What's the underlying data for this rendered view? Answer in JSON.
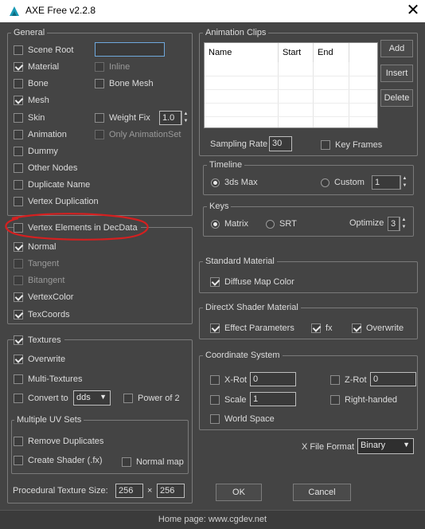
{
  "window": {
    "title": "AXE Free v2.2.8",
    "close_glyph": "✕",
    "icon": "axe-app-icon"
  },
  "general": {
    "title": "General",
    "scene_root": "Scene Root",
    "scene_root_value": "",
    "material": "Material",
    "inline": "Inline",
    "bone": "Bone",
    "bone_mesh": "Bone Mesh",
    "mesh": "Mesh",
    "skin": "Skin",
    "weight_fix": "Weight Fix",
    "weight_fix_value": "1.0",
    "animation": "Animation",
    "only_animation_set": "Only AnimationSet",
    "dummy": "Dummy",
    "other_nodes": "Other Nodes",
    "duplicate_name": "Duplicate Name",
    "vertex_duplication": "Vertex Duplication"
  },
  "vertex_elements": {
    "title": "Vertex Elements in DecData",
    "normal": "Normal",
    "tangent": "Tangent",
    "bitangent": "Bitangent",
    "vertex_color": "VertexColor",
    "tex_coords": "TexCoords"
  },
  "textures": {
    "title": "Textures",
    "overwrite": "Overwrite",
    "multi_textures": "Multi-Textures",
    "convert_to": "Convert to",
    "convert_format": "dds",
    "power_of_2": "Power of 2",
    "multiple_uv_sets": "Multiple UV Sets",
    "remove_duplicates": "Remove Duplicates",
    "create_shader": "Create Shader (.fx)",
    "normal_map": "Normal map",
    "procedural_size_label": "Procedural Texture Size:",
    "procedural_w": "256",
    "times": "×",
    "procedural_h": "256"
  },
  "animation_clips": {
    "title": "Animation Clips",
    "columns": [
      "Name",
      "Start",
      "End"
    ],
    "add": "Add",
    "insert": "Insert",
    "delete": "Delete",
    "sampling_rate_label": "Sampling Rate",
    "sampling_rate": "30",
    "key_frames": "Key Frames"
  },
  "timeline": {
    "title": "Timeline",
    "max": "3ds Max",
    "custom": "Custom",
    "custom_value": "1"
  },
  "keys": {
    "title": "Keys",
    "matrix": "Matrix",
    "srt": "SRT",
    "optimize": "Optimize",
    "optimize_value": "3"
  },
  "standard_material": {
    "title": "Standard Material",
    "diffuse_map_color": "Diffuse Map Color"
  },
  "directx_material": {
    "title": "DirectX Shader Material",
    "effect_parameters": "Effect Parameters",
    "fx": "fx",
    "overwrite": "Overwrite"
  },
  "coordinate_system": {
    "title": "Coordinate System",
    "x_rot": "X-Rot",
    "x_rot_value": "0",
    "z_rot": "Z-Rot",
    "z_rot_value": "0",
    "scale": "Scale",
    "scale_value": "1",
    "right_handed": "Right-handed",
    "world_space": "World Space"
  },
  "file_format": {
    "label": "X File Format",
    "value": "Binary"
  },
  "buttons": {
    "ok": "OK",
    "cancel": "Cancel"
  },
  "status": {
    "homepage": "Home page:  www.cgdev.net"
  },
  "colors": {
    "background": "#444444",
    "annotation_red": "#d42020"
  }
}
